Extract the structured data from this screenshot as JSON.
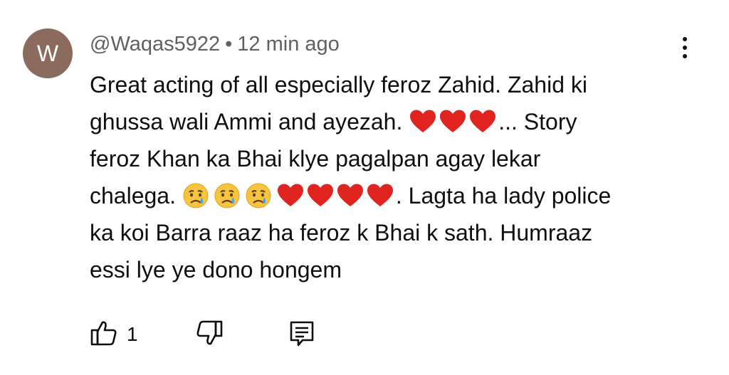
{
  "comment": {
    "avatar_letter": "W",
    "avatar_color": "#8a6b5e",
    "username": "@Waqas5922",
    "separator": "•",
    "time_ago": "12 min ago",
    "text_color": "#0f0f0f",
    "meta_color": "#606060",
    "emoji": {
      "heart": "red-heart",
      "cry": "crying-face"
    },
    "body": {
      "line1": "Great acting of all especially feroz Zahid. Zahid ki",
      "line2_a": "ghussa wali Ammi and ayezah.",
      "line2_b": "... Story",
      "line3": "feroz Khan ka Bhai klye pagalpan agay lekar",
      "line4_a": "chalega.",
      "line4_b": ". Lagta ha lady police",
      "line5": "ka koi Barra raaz ha feroz k Bhai k sath. Humraaz",
      "line6": "essi lye ye dono hongem"
    },
    "like_count": "1"
  }
}
